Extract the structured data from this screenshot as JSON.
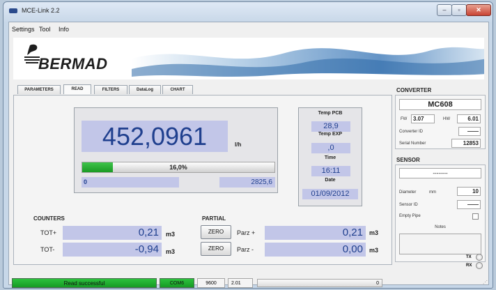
{
  "window": {
    "title": "MCE-Link 2.2",
    "min": "‒",
    "max": "▫",
    "close": "✕"
  },
  "menu": [
    "Settings",
    "Tool",
    "Info"
  ],
  "banner": {
    "logo_text": "BERMAD"
  },
  "tabs": [
    {
      "label": "PARAMETERS",
      "active": false
    },
    {
      "label": "READ",
      "active": true
    },
    {
      "label": "FILTERS",
      "active": false
    },
    {
      "label": "DataLog",
      "active": false
    },
    {
      "label": "CHART",
      "active": false
    }
  ],
  "read": {
    "flow_value": "452,0961",
    "flow_unit": "l/h",
    "progress_label": "16,0%",
    "progress_fraction": 0.16,
    "range_min": "0",
    "range_max": "2825,6",
    "temp_pcb_label": "Temp PCB",
    "temp_pcb_value": "28,9",
    "temp_exp_label": "Temp EXP",
    "temp_exp_value": ",0",
    "time_label": "Time",
    "time_value": "16:11",
    "date_label": "Date",
    "date_value": "01/09/2012"
  },
  "counters": {
    "title": "COUNTERS",
    "tot_plus_label": "TOT+",
    "tot_plus_value": "0,21",
    "tot_minus_label": "TOT-",
    "tot_minus_value": "-0,94",
    "unit": "m3"
  },
  "partial": {
    "title": "PARTIAL",
    "zero_label": "ZERO",
    "parz_plus_label": "Parz +",
    "parz_plus_value": "0,21",
    "parz_minus_label": "Parz -",
    "parz_minus_value": "0,00",
    "unit": "m3"
  },
  "converter": {
    "title": "CONVERTER",
    "model": "MC608",
    "fw_label": "FW",
    "fw_value": "3.07",
    "hw_label": "HW",
    "hw_value": "6.01",
    "id_label": "Converter ID",
    "id_value": "——",
    "serial_label": "Serial Number",
    "serial_value": "12853"
  },
  "sensor": {
    "title": "SENSOR",
    "name": "--------",
    "diameter_label": "Diameter",
    "diameter_unit": "mm",
    "diameter_value": "10",
    "id_label": "Sensor ID",
    "id_value": "——",
    "empty_pipe_label": "Empty Pipe",
    "notes_label": "Notes"
  },
  "leds": {
    "tx": "TX",
    "rx": "RX"
  },
  "status": {
    "message": "Read successful",
    "port": "COM6",
    "baud": "9600",
    "version": "2.01",
    "progress": "0"
  },
  "colors": {
    "value_bg": "#c2c6e8",
    "value_text": "#1f3f8e",
    "ok_green": "#2cc13d"
  }
}
